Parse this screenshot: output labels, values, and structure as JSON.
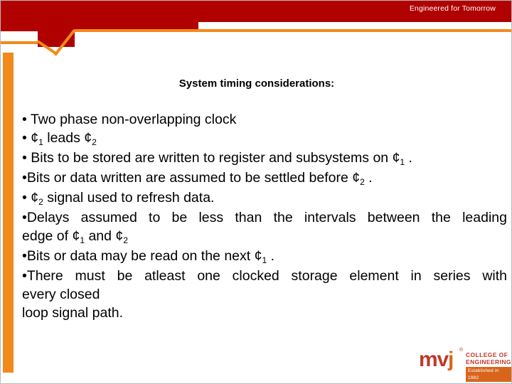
{
  "header": {
    "tagline": "Engineered for Tomorrow",
    "red_color": "#b00000",
    "orange_color": "#f28a1b"
  },
  "slide": {
    "title": "System timing considerations:",
    "lines": [
      {
        "id": "line-1",
        "text": "• Two phase non-overlapping clock",
        "justify": false
      },
      {
        "id": "line-2",
        "prefix": "• ¢",
        "sub1": "1",
        "mid": "  leads  ¢",
        "sub2": "2",
        "suffix": "",
        "justify": false
      },
      {
        "id": "line-3",
        "prefix": "• Bits to be stored are written to register and subsystems on  ¢",
        "sub1": "1",
        "mid": "",
        "sub2": "",
        "suffix": " .",
        "justify": false
      },
      {
        "id": "line-4",
        "prefix": "•Bits or data written are assumed to be settled before ¢",
        "sub1": "2",
        "mid": "",
        "sub2": "",
        "suffix": " .",
        "justify": false
      },
      {
        "id": "line-5",
        "prefix": "• ¢",
        "sub1": "2",
        "mid": "  signal used to refresh data.",
        "sub2": "",
        "suffix": "",
        "justify": false
      },
      {
        "id": "line-6",
        "text": "•Delays assumed to be less than the intervals between the leading",
        "justify": true
      },
      {
        "id": "line-7",
        "prefix": "edge of ¢",
        "sub1": "1",
        "mid": "  and ¢",
        "sub2": "2",
        "suffix": "",
        "justify": false
      },
      {
        "id": "line-8",
        "prefix": "•Bits or data may be read on the next ¢",
        "sub1": "1",
        "mid": "",
        "sub2": "",
        "suffix": " .",
        "justify": false
      },
      {
        "id": "line-9",
        "text": "•There must be atleast one clocked storage element in series with",
        "justify": true
      },
      {
        "id": "line-10",
        "text": "every closed",
        "justify": false
      },
      {
        "id": "line-11",
        "text": "loop signal path.",
        "justify": false
      }
    ]
  },
  "logo": {
    "mark_m": "m",
    "mark_v": "v",
    "mark_j": "j",
    "trademark": "®",
    "line1": "COLLEGE OF",
    "line2": "ENGINEERING",
    "established": "Established in 1982",
    "red": "#c0392b",
    "orange": "#d9651c"
  }
}
